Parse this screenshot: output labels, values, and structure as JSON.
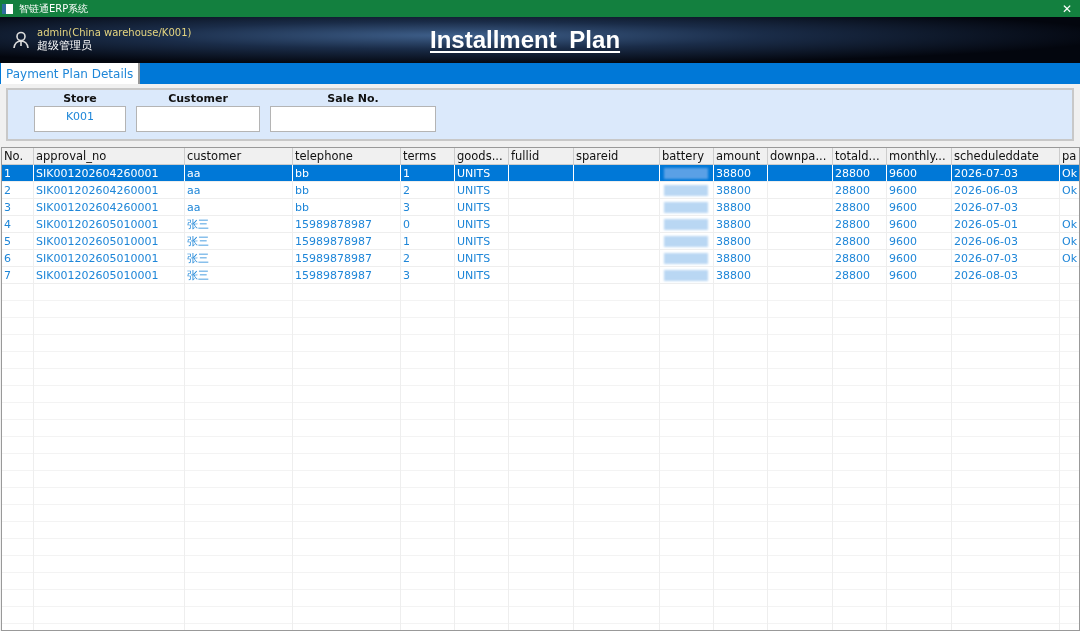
{
  "window": {
    "title": "智链通ERP系统",
    "close": "✕"
  },
  "header": {
    "user": "admin(China warehouse/K001)",
    "role": "超级管理员",
    "title": "Installment Plan"
  },
  "tabs": [
    {
      "label": "Payment Plan Details",
      "selected": true
    }
  ],
  "filters": [
    {
      "label": "Store",
      "value": "K001"
    },
    {
      "label": "Customer"
    },
    {
      "label": "Sale No."
    }
  ],
  "table": {
    "columns": [
      {
        "label": "No."
      },
      {
        "label": "approval_no"
      },
      {
        "label": "customer"
      },
      {
        "label": "telephone"
      },
      {
        "label": "terms"
      },
      {
        "label": "goods..."
      },
      {
        "label": "fullid"
      },
      {
        "label": "spareid"
      },
      {
        "label": "battery",
        "kind": "redacted"
      },
      {
        "label": "amount"
      },
      {
        "label": "downpa..."
      },
      {
        "label": "totald..."
      },
      {
        "label": "monthly..."
      },
      {
        "label": "scheduleddate"
      },
      {
        "label": "pa"
      }
    ],
    "rows": [
      {
        "selected": true,
        "cells": [
          "1",
          "SIK001202604260001",
          "aa",
          "bb",
          "1",
          "UNITS",
          null,
          null,
          null,
          "38800",
          null,
          "28800",
          "9600",
          "2026-07-03",
          "Ok"
        ]
      },
      {
        "selected": false,
        "cells": [
          "2",
          "SIK001202604260001",
          "aa",
          "bb",
          "2",
          "UNITS",
          null,
          null,
          null,
          "38800",
          null,
          "28800",
          "9600",
          "2026-06-03",
          "Ok"
        ]
      },
      {
        "selected": false,
        "cells": [
          "3",
          "SIK001202604260001",
          "aa",
          "bb",
          "3",
          "UNITS",
          null,
          null,
          null,
          "38800",
          null,
          "28800",
          "9600",
          "2026-07-03",
          null
        ]
      },
      {
        "selected": false,
        "cells": [
          "4",
          "SIK001202605010001",
          "张三",
          "15989878987",
          "0",
          "UNITS",
          null,
          null,
          null,
          "38800",
          null,
          "28800",
          "9600",
          "2026-05-01",
          "Ok"
        ]
      },
      {
        "selected": false,
        "cells": [
          "5",
          "SIK001202605010001",
          "张三",
          "15989878987",
          "1",
          "UNITS",
          null,
          null,
          null,
          "38800",
          null,
          "28800",
          "9600",
          "2026-06-03",
          "Ok"
        ]
      },
      {
        "selected": false,
        "cells": [
          "6",
          "SIK001202605010001",
          "张三",
          "15989878987",
          "2",
          "UNITS",
          null,
          null,
          null,
          "38800",
          null,
          "28800",
          "9600",
          "2026-07-03",
          "Ok"
        ]
      },
      {
        "selected": false,
        "cells": [
          "7",
          "SIK001202605010001",
          "张三",
          "15989878987",
          "3",
          "UNITS",
          null,
          null,
          null,
          "38800",
          null,
          "28800",
          "9600",
          "2026-08-03",
          null
        ]
      }
    ]
  }
}
